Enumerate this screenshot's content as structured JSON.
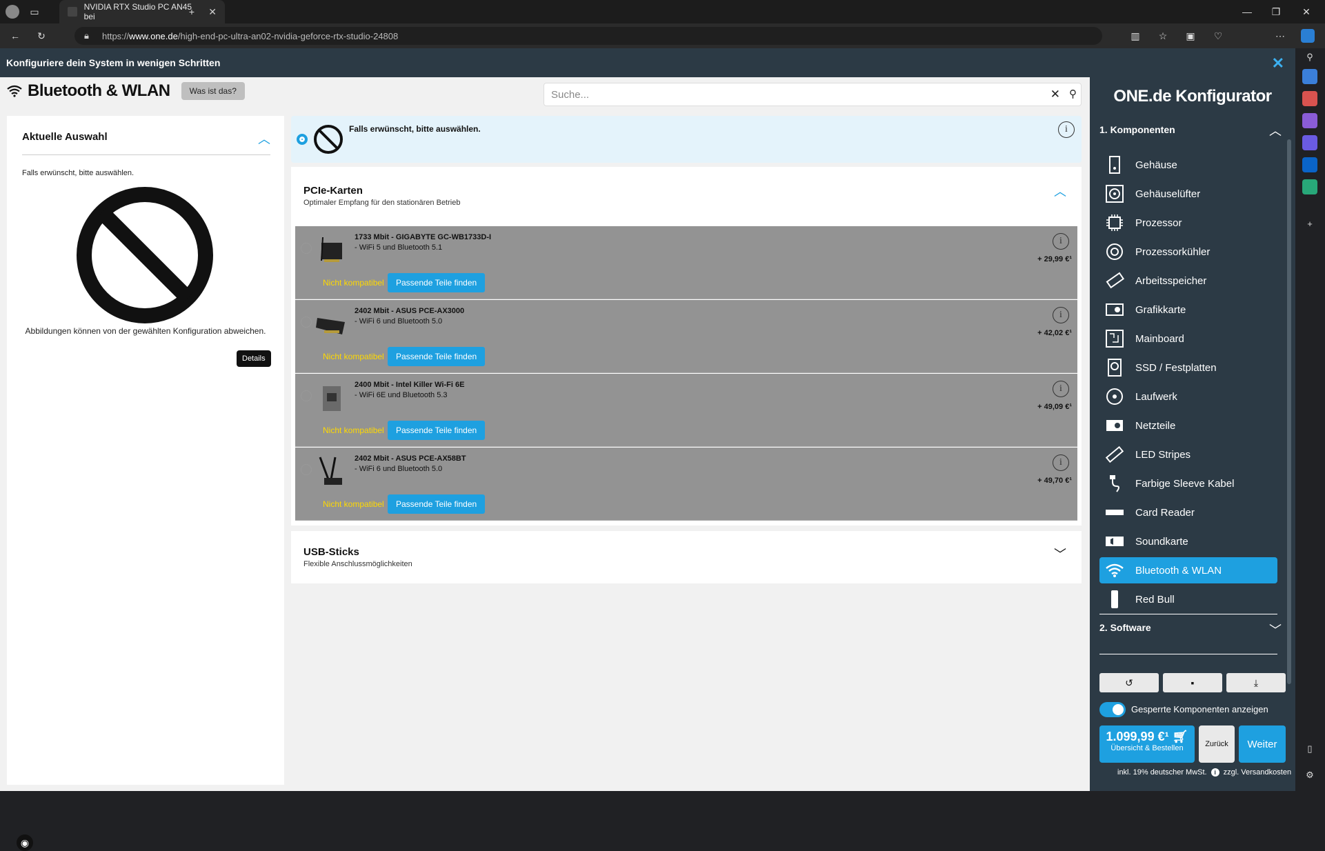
{
  "browser": {
    "tab_title": "NVIDIA RTX Studio PC AN45 bei",
    "url_prefix": "https://",
    "url_domain": "www.one.de",
    "url_path": "/high-end-pc-ultra-an02-nvidia-geforce-rtx-studio-24808"
  },
  "top_strip": {
    "title": "Konfiguriere dein System in wenigen Schritten"
  },
  "category": {
    "title": "Bluetooth & WLAN",
    "what_button": "Was ist das?"
  },
  "search": {
    "placeholder": "Suche..."
  },
  "current_selection": {
    "title": "Aktuelle Auswahl",
    "subtitle": "Falls erwünscht, bitte auswählen.",
    "note": "Abbildungen können von der gewählten Konfiguration abweichen.",
    "details_button": "Details"
  },
  "selected_option": {
    "label": "Falls erwünscht, bitte auswählen."
  },
  "pcie": {
    "title": "PCIe-Karten",
    "subtitle": "Optimaler Empfang für den stationären Betrieb",
    "products": [
      {
        "name": "1733 Mbit - GIGABYTE GC-WB1733D-I",
        "feature": "- WiFi 5 und Bluetooth 5.1",
        "status": "Nicht kompatibel",
        "button": "Passende Teile finden",
        "price": "+ 29,99 €¹"
      },
      {
        "name": "2402 Mbit - ASUS PCE-AX3000",
        "feature": "- WiFi 6 und Bluetooth 5.0",
        "status": "Nicht kompatibel",
        "button": "Passende Teile finden",
        "price": "+ 42,02 €¹"
      },
      {
        "name": "2400 Mbit - Intel Killer Wi-Fi 6E",
        "feature": "- WiFi 6E und Bluetooth 5.3",
        "status": "Nicht kompatibel",
        "button": "Passende Teile finden",
        "price": "+ 49,09 €¹"
      },
      {
        "name": "2402 Mbit - ASUS PCE-AX58BT",
        "feature": "- WiFi 6 und Bluetooth 5.0",
        "status": "Nicht kompatibel",
        "button": "Passende Teile finden",
        "price": "+ 49,70 €¹"
      }
    ]
  },
  "usb": {
    "title": "USB-Sticks",
    "subtitle": "Flexible Anschlussmöglichkeiten"
  },
  "sidebar": {
    "title": "ONE.de Konfigurator",
    "section1": "1. Komponenten",
    "items": [
      {
        "label": "Gehäuse",
        "icon": "case-icon"
      },
      {
        "label": "Gehäuselüfter",
        "icon": "fan-icon"
      },
      {
        "label": "Prozessor",
        "icon": "cpu-icon"
      },
      {
        "label": "Prozessorkühler",
        "icon": "cooler-icon"
      },
      {
        "label": "Arbeitsspeicher",
        "icon": "ram-icon"
      },
      {
        "label": "Grafikkarte",
        "icon": "gpu-icon"
      },
      {
        "label": "Mainboard",
        "icon": "mainboard-icon"
      },
      {
        "label": "SSD / Festplatten",
        "icon": "drive-icon"
      },
      {
        "label": "Laufwerk",
        "icon": "disc-icon"
      },
      {
        "label": "Netzteile",
        "icon": "psu-icon"
      },
      {
        "label": "LED Stripes",
        "icon": "led-icon"
      },
      {
        "label": "Farbige Sleeve Kabel",
        "icon": "cable-icon"
      },
      {
        "label": "Card Reader",
        "icon": "card-reader-icon"
      },
      {
        "label": "Soundkarte",
        "icon": "sound-icon"
      },
      {
        "label": "Bluetooth & WLAN",
        "icon": "wifi-icon",
        "active": true
      },
      {
        "label": "Red Bull",
        "icon": "can-icon"
      }
    ],
    "section2": "2. Software",
    "toggle_label": "Gesperrte Komponenten anzeigen",
    "price": "1.099,99 €¹",
    "price_sub": "Übersicht & Bestellen",
    "back": "Zurück",
    "next": "Weiter",
    "tax_note": "inkl. 19% deutscher MwSt.",
    "shipping_note": "zzgl. Versandkosten"
  },
  "colors": {
    "accent": "#1ea0e0",
    "sidebar_bg": "#2c3a45",
    "incompatible": "#ffd900"
  }
}
